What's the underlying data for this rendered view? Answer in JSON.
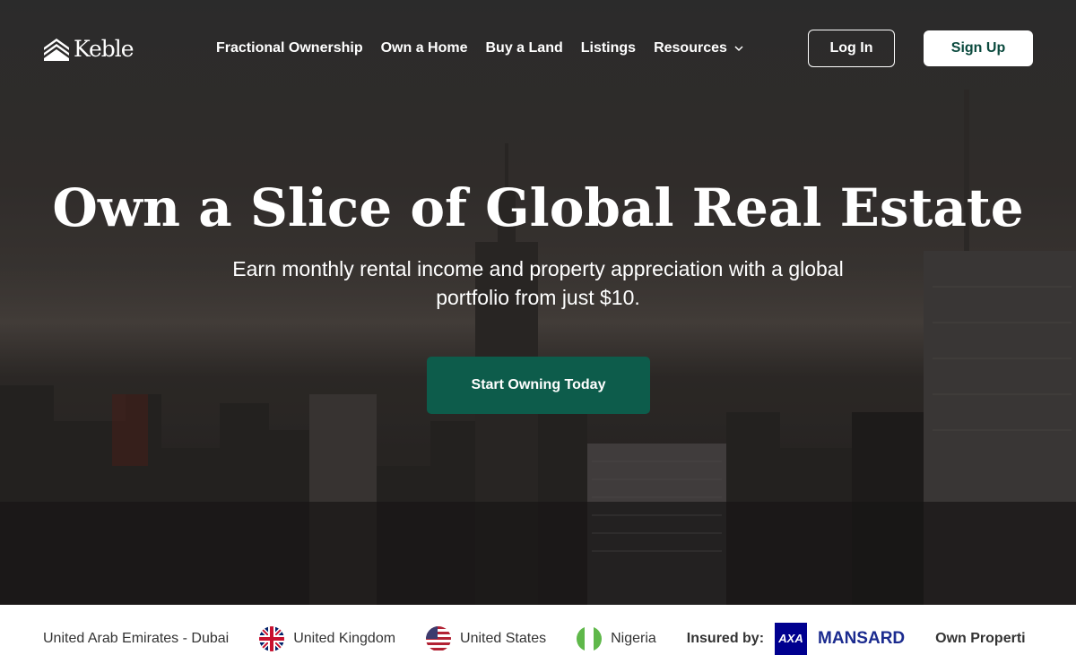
{
  "brand": {
    "name": "Keble"
  },
  "nav": {
    "items": [
      {
        "label": "Fractional Ownership"
      },
      {
        "label": "Own a Home"
      },
      {
        "label": "Buy a Land"
      },
      {
        "label": "Listings"
      },
      {
        "label": "Resources"
      }
    ],
    "login_label": "Log In",
    "signup_label": "Sign Up"
  },
  "hero": {
    "title": "Own a Slice of Global Real Estate",
    "subtitle": "Earn monthly rental income and property appreciation with a global portfolio from just $10.",
    "cta_label": "Start Owning Today"
  },
  "strip": {
    "countries": [
      {
        "label": "United Arab Emirates - Dubai",
        "flag": ""
      },
      {
        "label": "United Kingdom",
        "flag": "uk-flag-icon"
      },
      {
        "label": "United States",
        "flag": "us-flag-icon"
      },
      {
        "label": "Nigeria",
        "flag": "nigeria-flag-icon"
      }
    ],
    "insured_label": "Insured by:",
    "insurer_mark": "AXA",
    "insurer_name": "MANSARD",
    "trailing_text": "Own Properti"
  },
  "colors": {
    "brand_green": "#0d5c4b",
    "signup_text": "#0b4a3e",
    "axa_blue": "#00008f"
  }
}
